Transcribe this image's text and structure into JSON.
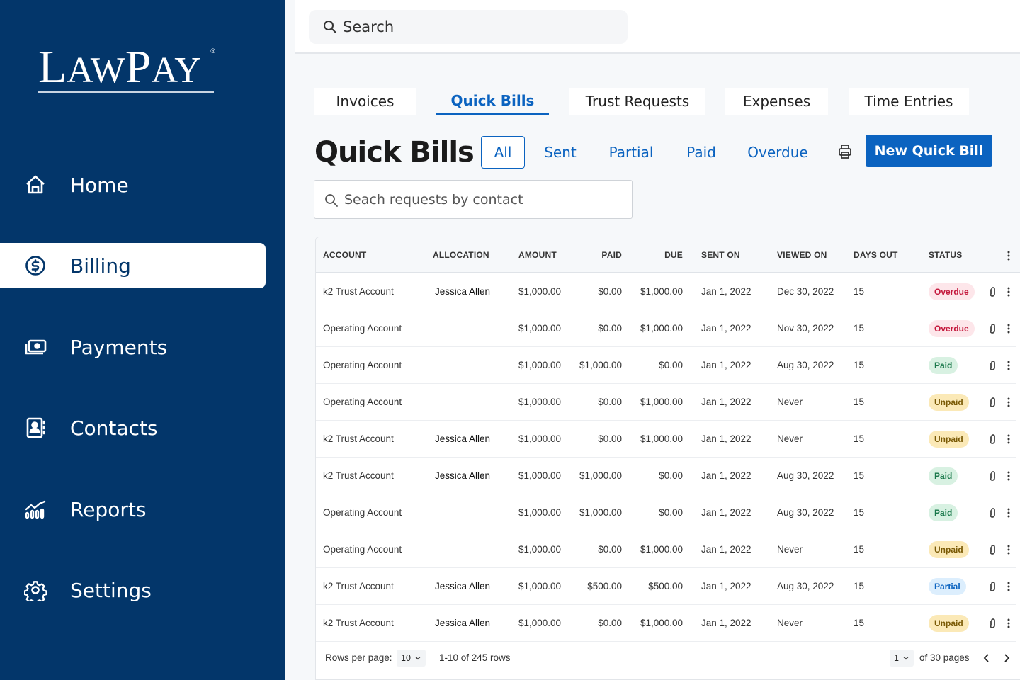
{
  "brand": {
    "name_first": "L",
    "name_rest1": "AW",
    "name_p": "P",
    "name_rest2": "AY",
    "registered": "®"
  },
  "sidebar": {
    "items": [
      {
        "label": "Home",
        "icon": "home-icon",
        "active": false
      },
      {
        "label": "Billing",
        "icon": "dollar-circle-icon",
        "active": true
      },
      {
        "label": "Payments",
        "icon": "cash-icon",
        "active": false
      },
      {
        "label": "Contacts",
        "icon": "contact-book-icon",
        "active": false
      },
      {
        "label": "Reports",
        "icon": "chart-icon",
        "active": false
      },
      {
        "label": "Settings",
        "icon": "gear-icon",
        "active": false
      }
    ]
  },
  "topbar": {
    "search_placeholder": "Search"
  },
  "tabs": [
    {
      "label": "Invoices",
      "active": false
    },
    {
      "label": "Quick Bills",
      "active": true
    },
    {
      "label": "Trust Requests",
      "active": false
    },
    {
      "label": "Expenses",
      "active": false
    },
    {
      "label": "Time Entries",
      "active": false
    }
  ],
  "page": {
    "title": "Quick Bills",
    "filters": [
      {
        "label": "All",
        "active": true
      },
      {
        "label": "Sent",
        "active": false
      },
      {
        "label": "Partial",
        "active": false
      },
      {
        "label": "Paid",
        "active": false
      },
      {
        "label": "Overdue",
        "active": false
      }
    ],
    "new_button": "New Quick Bill",
    "contact_search_placeholder": "Seach requests by contact"
  },
  "table": {
    "columns": [
      "ACCOUNT",
      "ALLOCATION",
      "AMOUNT",
      "PAID",
      "DUE",
      "SENT ON",
      "VIEWED ON",
      "DAYS OUT",
      "STATUS"
    ],
    "rows": [
      {
        "account": "k2 Trust Account",
        "allocation": "Jessica Allen",
        "amount": "$1,000.00",
        "paid": "$0.00",
        "due": "$1,000.00",
        "sent_on": "Jan 1, 2022",
        "viewed_on": "Dec 30, 2022",
        "days_out": "15",
        "status": "Overdue"
      },
      {
        "account": "Operating Account",
        "allocation": "",
        "amount": "$1,000.00",
        "paid": "$0.00",
        "due": "$1,000.00",
        "sent_on": "Jan 1, 2022",
        "viewed_on": "Nov 30, 2022",
        "days_out": "15",
        "status": "Overdue"
      },
      {
        "account": "Operating Account",
        "allocation": "",
        "amount": "$1,000.00",
        "paid": "$1,000.00",
        "due": "$0.00",
        "sent_on": "Jan 1, 2022",
        "viewed_on": "Aug 30, 2022",
        "days_out": "15",
        "status": "Paid"
      },
      {
        "account": "Operating Account",
        "allocation": "",
        "amount": "$1,000.00",
        "paid": "$0.00",
        "due": "$1,000.00",
        "sent_on": "Jan 1, 2022",
        "viewed_on": "Never",
        "days_out": "15",
        "status": "Unpaid"
      },
      {
        "account": "k2 Trust Account",
        "allocation": "Jessica Allen",
        "amount": "$1,000.00",
        "paid": "$0.00",
        "due": "$1,000.00",
        "sent_on": "Jan 1, 2022",
        "viewed_on": "Never",
        "days_out": "15",
        "status": "Unpaid"
      },
      {
        "account": "k2 Trust Account",
        "allocation": "Jessica Allen",
        "amount": "$1,000.00",
        "paid": "$1,000.00",
        "due": "$0.00",
        "sent_on": "Jan 1, 2022",
        "viewed_on": "Aug 30, 2022",
        "days_out": "15",
        "status": "Paid"
      },
      {
        "account": "Operating Account",
        "allocation": "",
        "amount": "$1,000.00",
        "paid": "$1,000.00",
        "due": "$0.00",
        "sent_on": "Jan 1, 2022",
        "viewed_on": "Aug 30, 2022",
        "days_out": "15",
        "status": "Paid"
      },
      {
        "account": "Operating Account",
        "allocation": "",
        "amount": "$1,000.00",
        "paid": "$0.00",
        "due": "$1,000.00",
        "sent_on": "Jan 1, 2022",
        "viewed_on": "Never",
        "days_out": "15",
        "status": "Unpaid"
      },
      {
        "account": "k2 Trust Account",
        "allocation": "Jessica Allen",
        "amount": "$1,000.00",
        "paid": "$500.00",
        "due": "$500.00",
        "sent_on": "Jan 1, 2022",
        "viewed_on": "Aug 30, 2022",
        "days_out": "15",
        "status": "Partial"
      },
      {
        "account": "k2 Trust Account",
        "allocation": "Jessica Allen",
        "amount": "$1,000.00",
        "paid": "$0.00",
        "due": "$1,000.00",
        "sent_on": "Jan 1, 2022",
        "viewed_on": "Never",
        "days_out": "15",
        "status": "Unpaid"
      }
    ]
  },
  "pagination": {
    "rows_per_page_label": "Rows per page:",
    "rows_per_page": "10",
    "range": "1-10 of 245 rows",
    "page": "1",
    "of_pages": "of 30 pages"
  },
  "colors": {
    "sidebar_bg": "#03366a",
    "accent": "#0b63c0",
    "overdue": "#c4183c",
    "paid": "#19784a",
    "unpaid": "#7a5a06",
    "partial": "#0b63c0"
  }
}
